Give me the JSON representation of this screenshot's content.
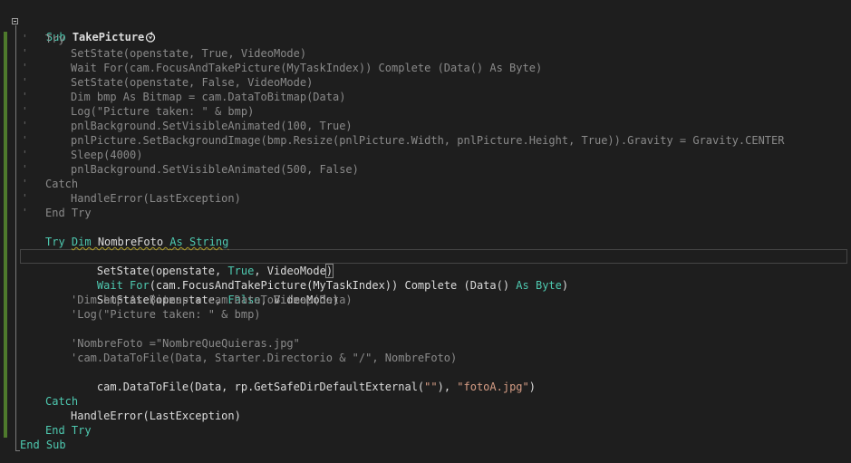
{
  "colors": {
    "background": "#1e1e1e",
    "keyword": "#4ec9b0",
    "comment": "#8a8a8a",
    "string": "#d69d85",
    "text": "#dcdcdc",
    "change_bar": "#4e7a2c"
  },
  "icons": {
    "fold": "collapse-icon",
    "refresh": "refresh-icon"
  },
  "code": {
    "l1_sub": "Sub ",
    "l1_name": "TakePicture",
    "l2": "Try",
    "l3": "SetState(openstate, True, VideoMode)",
    "l4": "Wait For(cam.FocusAndTakePicture(MyTaskIndex)) Complete (Data() As Byte)",
    "l5": "SetState(openstate, False, VideoMode)",
    "l6": "Dim bmp As Bitmap = cam.DataToBitmap(Data)",
    "l7": "Log(\"Picture taken: \" & bmp)",
    "l8": "pnlBackground.SetVisibleAnimated(100, True)",
    "l9": "pnlPicture.SetBackgroundImage(bmp.Resize(pnlPicture.Width, pnlPicture.Height, True)).Gravity = Gravity.CENTER",
    "l10": "Sleep(4000)",
    "l11": "pnlBackground.SetVisibleAnimated(500, False)",
    "l12": "Catch",
    "l13": "HandleError(LastException)",
    "l14": "End Try",
    "l15_dim": "Dim",
    "l15_name": " NombreFoto ",
    "l15_as": "As",
    "l15_type": " String",
    "l16": "Try",
    "l17_a": "SetState(",
    "l17_b": "openstate",
    "l17_c": ", ",
    "l17_d": "True",
    "l17_e": ", ",
    "l17_f": "VideoMode",
    "l17_g": ")",
    "l18_a": "Wait For",
    "l18_b": "(cam.FocusAndTakePicture(MyTaskIndex)) ",
    "l18_c": "Complete",
    "l18_d": " (Data() ",
    "l18_e": "As",
    "l18_f": " ",
    "l18_g": "Byte",
    "l18_h": ")",
    "l19_a": "SetState(openstate, ",
    "l19_b": "False",
    "l19_c": ", VideoMode)",
    "l20": "'Dim bmp As Bitmap = cam.DataToBitmap(Data)",
    "l21": "'Log(\"Picture taken: \" & bmp)",
    "l22": "'NombreFoto =\"NombreQueQuieras.jpg\"",
    "l23": "'cam.DataToFile(Data, Starter.Directorio & \"/\", NombreFoto)",
    "l24_a": "cam.DataToFile(Data, rp.GetSafeDirDefaultExternal(",
    "l24_b": "\"\"",
    "l24_c": "), ",
    "l24_d": "\"fotoA.jpg\"",
    "l24_e": ")",
    "l25": "Catch",
    "l26": "HandleError(LastException)",
    "l27": "End Try",
    "l28": "End Sub",
    "comment_mark": "'"
  }
}
